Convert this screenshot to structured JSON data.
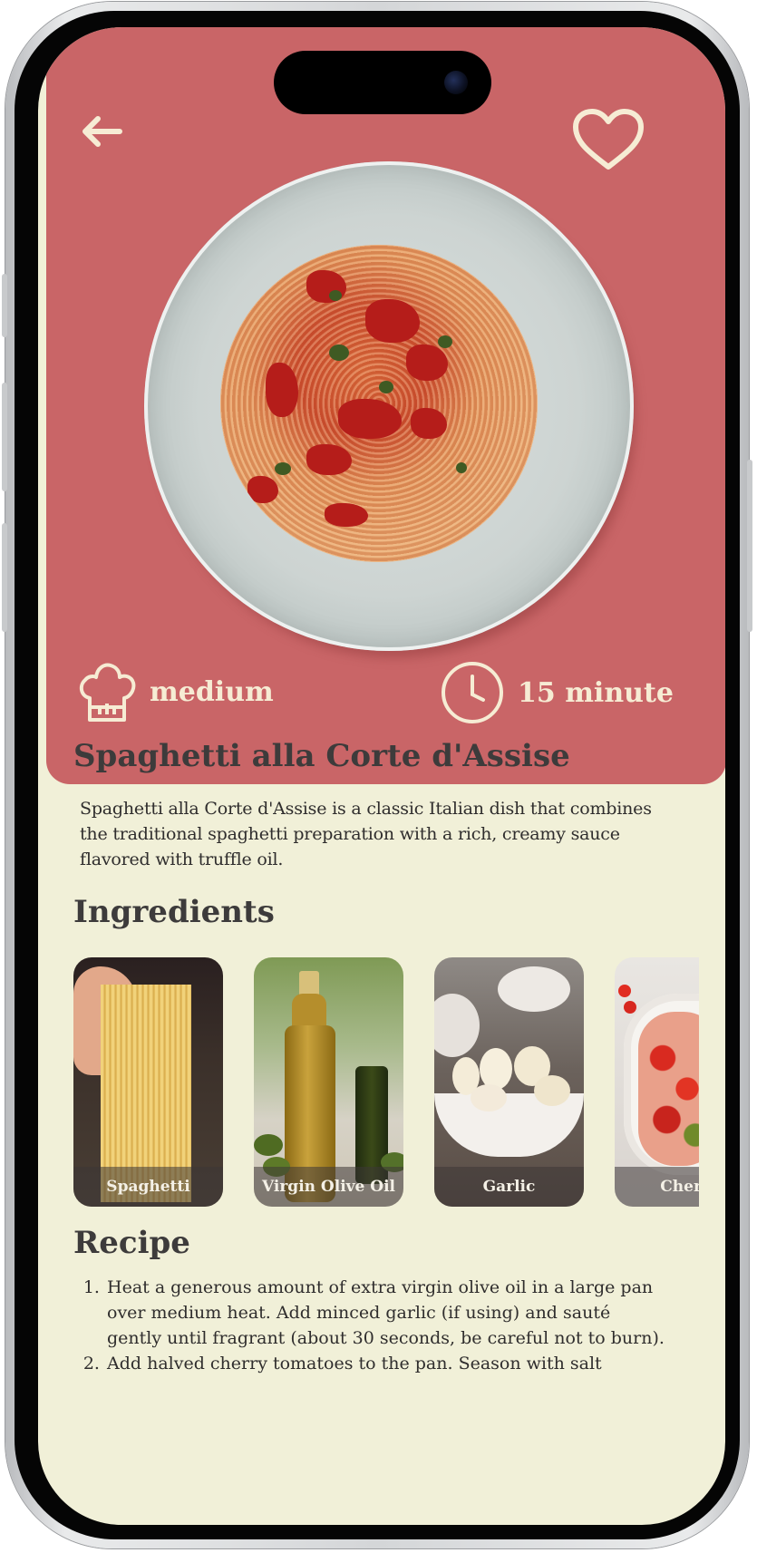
{
  "header": {
    "back_icon": "arrow-left-icon",
    "favorite_icon": "heart-icon"
  },
  "hero": {
    "difficulty_icon": "chef-hat-icon",
    "difficulty": "medium",
    "time_icon": "clock-icon",
    "time": "15 minute",
    "colors": {
      "hero_bg": "#c96567",
      "accent_text": "#f6ecd4",
      "page_bg": "#f1f0d8"
    }
  },
  "dish": {
    "title": "Spaghetti alla Corte d'Assise",
    "description": "Spaghetti alla Corte d'Assise is a classic Italian dish that combines  the traditional spaghetti preparation with a rich, creamy sauce flavored with truffle oil."
  },
  "ingredients": {
    "heading": "Ingredients",
    "items": [
      {
        "label": "Spaghetti"
      },
      {
        "label": "Virgin Olive Oil"
      },
      {
        "label": "Garlic"
      },
      {
        "label": "Cherry"
      }
    ]
  },
  "recipe": {
    "heading": "Recipe",
    "steps": [
      "Heat a generous amount of extra virgin olive oil in a large pan over medium  heat. Add minced garlic (if using) and sauté gently until fragrant  (about 30 seconds, be careful not to burn).",
      "Add halved cherry tomatoes to the pan. Season with salt"
    ]
  }
}
